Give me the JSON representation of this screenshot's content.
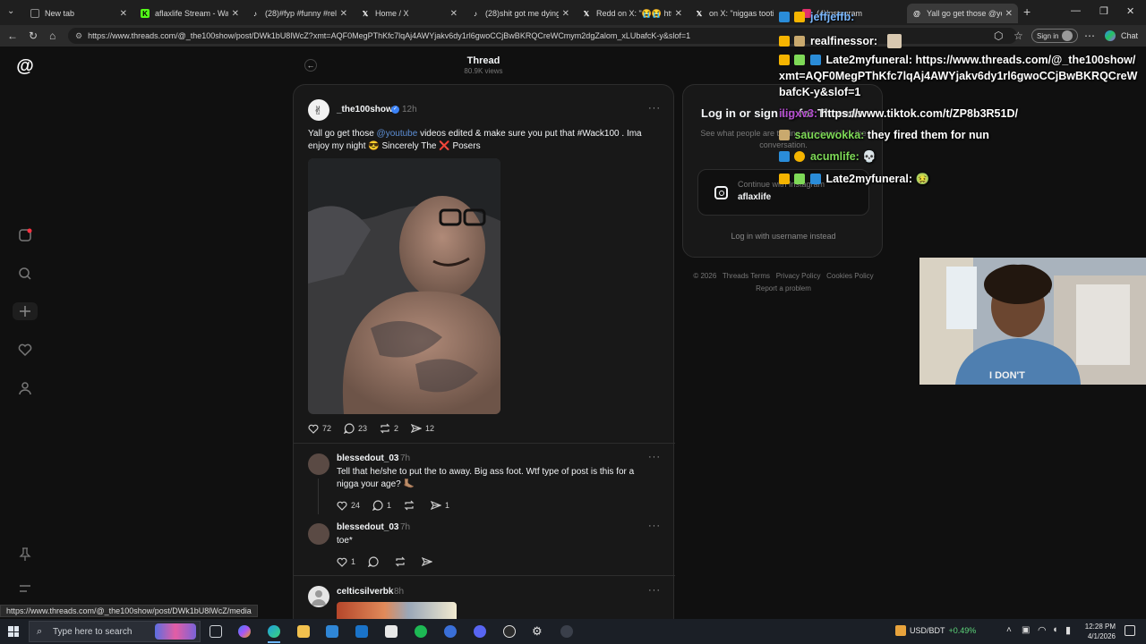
{
  "browser": {
    "tabs": [
      {
        "label": "New tab",
        "icon": "new-tab-icon",
        "color": "#888888"
      },
      {
        "label": "aflaxlife Stream - Watch",
        "icon": "kick-icon",
        "color": "#53fc18"
      },
      {
        "label": "(28)#fyp #funny #relata",
        "icon": "tiktok-icon",
        "color": "#ffffff"
      },
      {
        "label": "Home / X",
        "icon": "x-icon",
        "color": "#ffffff"
      },
      {
        "label": "(28)shit got me dying😭",
        "icon": "tiktok-icon",
        "color": "#ffffff"
      },
      {
        "label": "Redd on X: \"😭😭 http",
        "icon": "x-icon",
        "color": "#ffffff"
      },
      {
        "label": "on X: \"niggas tootin",
        "icon": "x-icon",
        "color": "#ffffff"
      },
      {
        "label": "(4)Instagram",
        "icon": "instagram-icon",
        "color": "#e1306c"
      },
      {
        "label": "Yall go get those @yout",
        "icon": "threads-icon",
        "color": "#ffffff"
      }
    ],
    "url": "https://www.threads.com/@_the100show/post/DWk1bU8lWcZ?xmt=AQF0MegPThKfc7lqAj4AWYjakv6dy1rl6gwoCCjBwBKRQCreWCmym2dgZalom_xLUbafcK-y&slof=1",
    "signin_label": "Sign in",
    "chat_label": "Chat",
    "status_url": "https://www.threads.com/@_the100show/post/DWk1bU8lWcZ/media"
  },
  "thread": {
    "title": "Thread",
    "views": "80.9K views"
  },
  "post": {
    "username": "_the100show",
    "time": "12h",
    "text_parts": [
      "Yall go get those ",
      "@youtube",
      " videos edited & make sure you put that #Wack100 . Ima enjoy my night 😎 Sincerely The ❌ Posers"
    ],
    "likes": "72",
    "comments": "23",
    "reposts": "2",
    "shares": "12"
  },
  "replies": [
    {
      "username": "blessedout_03",
      "time": "7h",
      "text": "Tell that he/she to put the to away. Big ass foot. Wtf type of post is this for a nigga your age? 🦶🏽",
      "likes": "24",
      "comments": "1",
      "reposts": "",
      "shares": "1"
    },
    {
      "username": "blessedout_03",
      "time": "7h",
      "text": "toe*",
      "likes": "1",
      "comments": "",
      "reposts": "",
      "shares": ""
    },
    {
      "username": "celticsilverbk",
      "time": "8h",
      "text": ""
    }
  ],
  "login": {
    "title": "Log in or sign up for Threads",
    "subtitle": "See what people are talking about and join the conversation.",
    "continue_label": "Continue with Instagram",
    "account": "aflaxlife",
    "username_link": "Log in with username instead"
  },
  "footer": {
    "copyright": "© 2026",
    "terms": "Threads Terms",
    "privacy": "Privacy Policy",
    "cookies": "Cookies Policy",
    "report": "Report a problem"
  },
  "chat": [
    {
      "name": "jeffjeffb:",
      "text": ""
    },
    {
      "name": "realfinessor:",
      "text": ""
    },
    {
      "name": "Late2myfuneral:",
      "text": "https://www.threads.com/@_the100show/"
    },
    {
      "name": "",
      "text": "xmt=AQF0MegPThKfc7lqAj4AWYjakv6dy1rl6gwoCCjBwBKRQCreW"
    },
    {
      "name": "",
      "text": "bafcK-y&slof=1"
    },
    {
      "name": "iligxv3:",
      "text": "https://www.tiktok.com/t/ZP8b3R51D/"
    },
    {
      "name": "saucewokka:",
      "text": "they fired them for nun"
    },
    {
      "name": "acumlife:",
      "text": "💀"
    },
    {
      "name": "Late2myfuneral:",
      "text": "🤢"
    }
  ],
  "webcam": {
    "shirt_text": "I DON'T"
  },
  "taskbar": {
    "search_placeholder": "Type here to search",
    "ticker_label": "USD/BDT",
    "ticker_change": "+0.49%",
    "time": "12:28 PM",
    "date": "4/1/2026"
  }
}
